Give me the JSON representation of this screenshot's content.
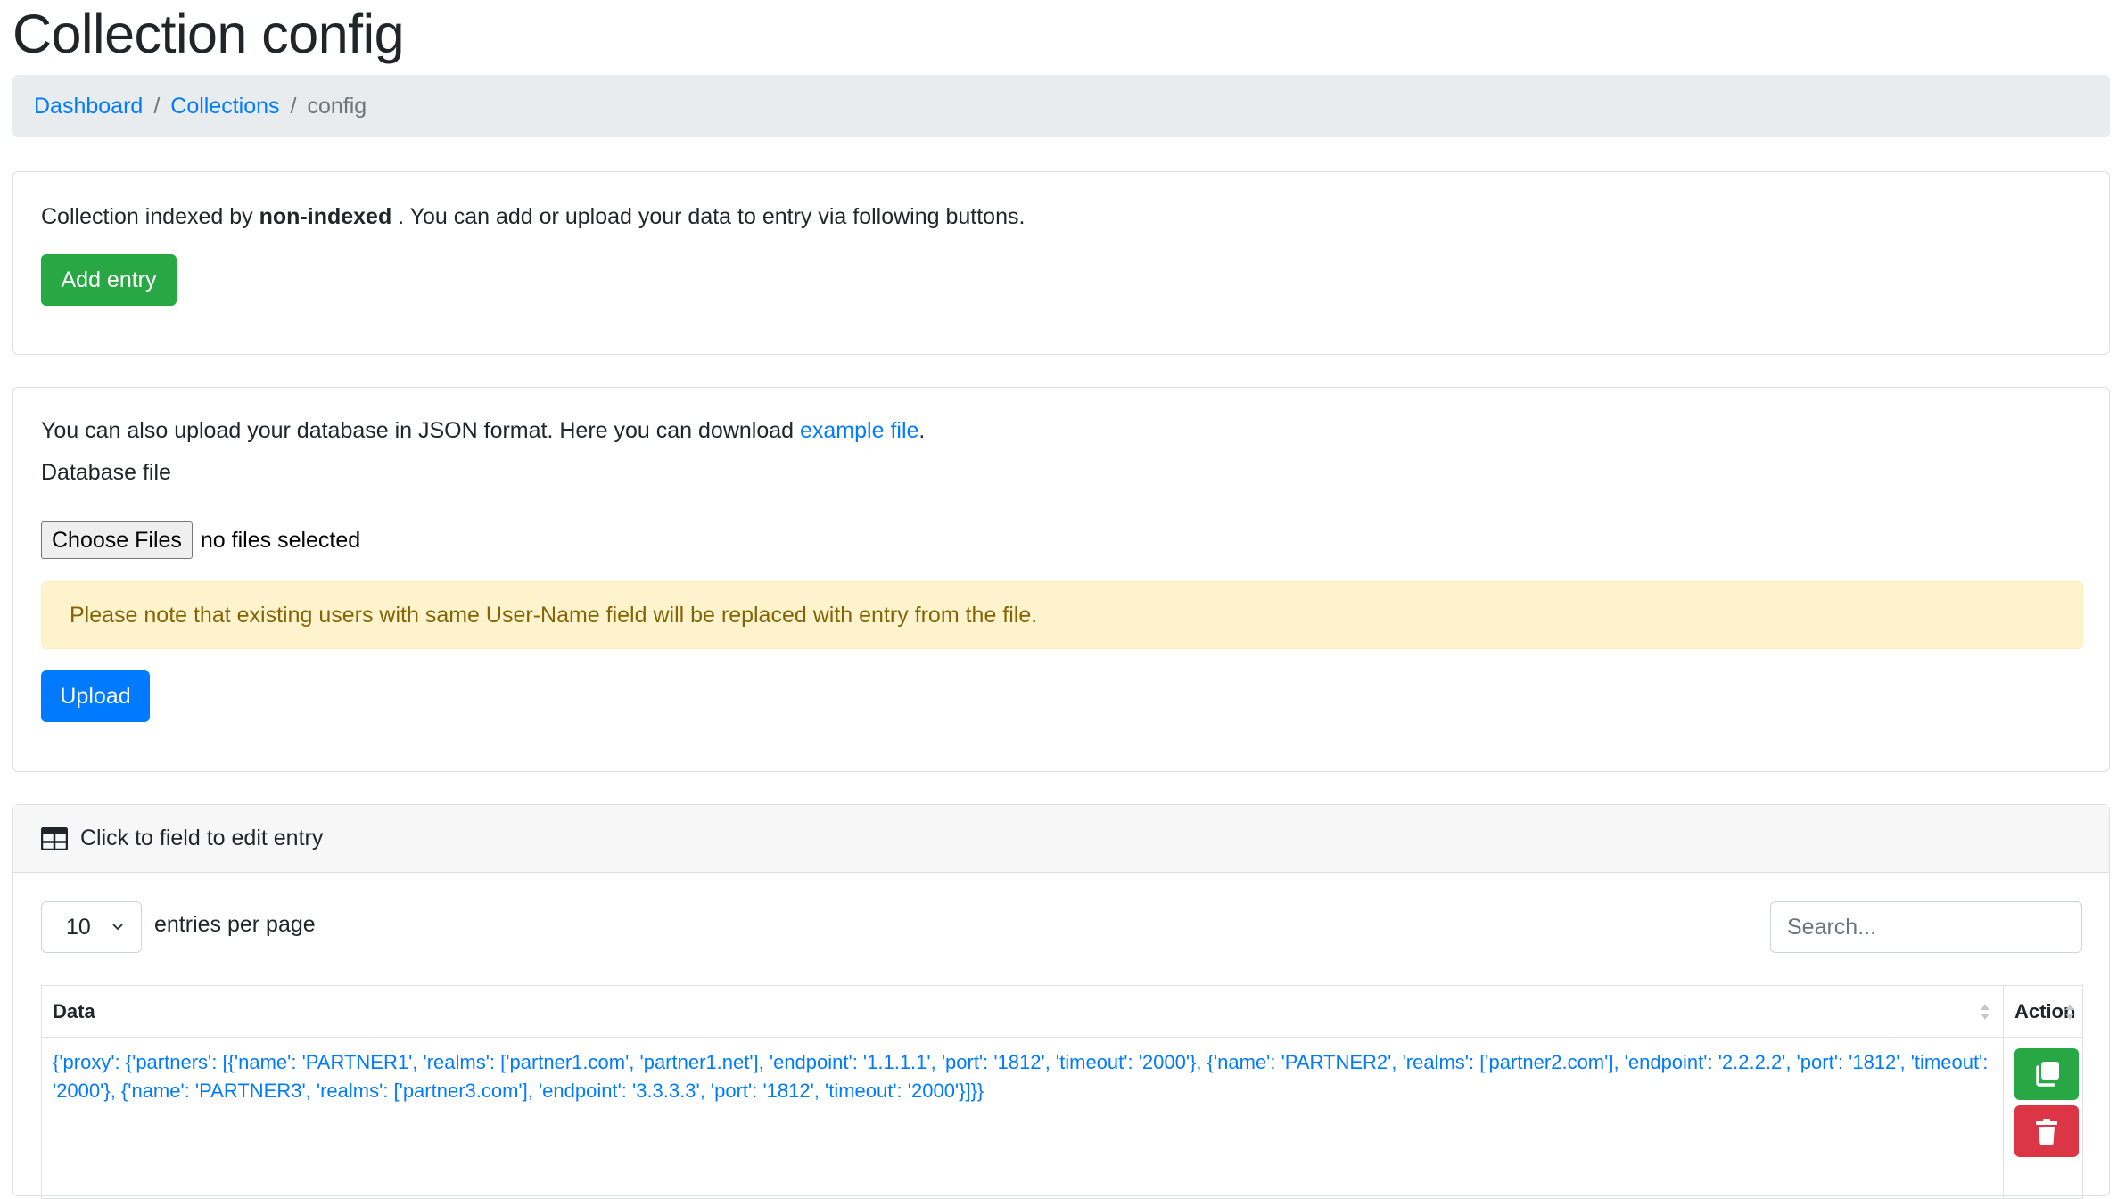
{
  "page": {
    "title": "Collection config"
  },
  "breadcrumb": [
    {
      "label": "Dashboard"
    },
    {
      "label": "Collections"
    },
    {
      "label": "config"
    }
  ],
  "index_card": {
    "text_before": "Collection indexed by",
    "index_name": "non-indexed",
    "text_after": ". You can add or upload your data to entry via following buttons.",
    "add_button": "Add entry"
  },
  "upload_card": {
    "text_before": "You can also upload your database in JSON format. Here you can download",
    "example_link": "example file",
    "text_after": ".",
    "file_label": "Database file",
    "choose_button": "Choose Files",
    "file_status": "no files selected",
    "warning": "Please note that existing users with same User-Name field will be replaced with entry from the file.",
    "upload_button": "Upload"
  },
  "table_card": {
    "header": "Click to field to edit entry",
    "per_page_value": "10",
    "per_page_label": "entries per page",
    "search_placeholder": "Search...",
    "columns": {
      "data": "Data",
      "action": "Action"
    },
    "rows": [
      {
        "data": "{'proxy': {'partners': [{'name': 'PARTNER1', 'realms': ['partner1.com', 'partner1.net'], 'endpoint': '1.1.1.1', 'port': '1812', 'timeout': '2000'}, {'name': 'PARTNER2', 'realms': ['partner2.com'], 'endpoint': '2.2.2.2', 'port': '1812', 'timeout': '2000'}, {'name': 'PARTNER3', 'realms': ['partner3.com'], 'endpoint': '3.3.3.3', 'port': '1812', 'timeout': '2000'}]}}"
      }
    ]
  },
  "icons": {
    "table": "table-icon",
    "duplicate": "copy-icon",
    "delete": "trash-icon",
    "sort": "sort-icon",
    "dropdown": "chevron-down-icon"
  },
  "colors": {
    "success": "#28a745",
    "primary": "#007bff",
    "danger": "#dc3545",
    "warning_bg": "#fff3cd",
    "warning_text": "#856404",
    "breadcrumb_bg": "#e9ecef"
  }
}
